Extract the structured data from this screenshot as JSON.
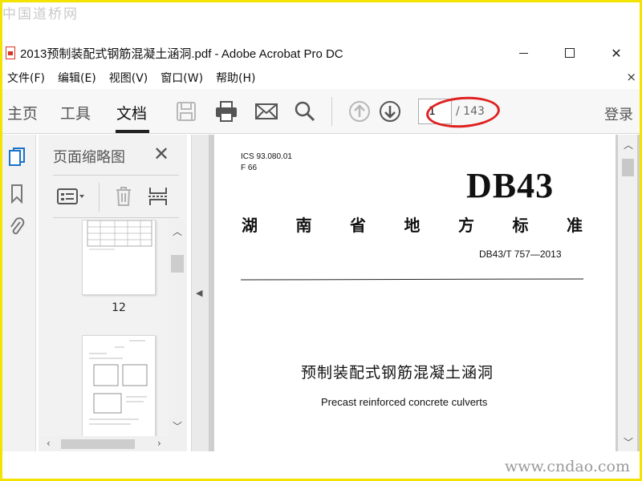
{
  "watermark": {
    "top": "中国道桥网",
    "bottom": "www.cndao.com"
  },
  "window": {
    "title": "2013预制装配式钢筋混凝土涵洞.pdf - Adobe Acrobat Pro DC",
    "close_glyph": "✕"
  },
  "menu": {
    "items": [
      "文件(F)",
      "编辑(E)",
      "视图(V)",
      "窗口(W)",
      "帮助(H)"
    ],
    "close_glyph": "×"
  },
  "toolbar": {
    "tabs": {
      "home": "主页",
      "tools": "工具",
      "document": "文档"
    },
    "page_number": "1",
    "page_total": "/ 143",
    "login": "登录"
  },
  "thumbnails": {
    "title": "页面缩略图",
    "close_glyph": "✕",
    "pages": [
      {
        "label": "12"
      },
      {
        "label": ""
      }
    ]
  },
  "document": {
    "ics": "ICS 93.080.01",
    "f_code": "F 66",
    "db_code": "DB43",
    "std_chars": [
      "湖",
      "南",
      "省",
      "地",
      "方",
      "标",
      "准"
    ],
    "std_number": "DB43/T 757—2013",
    "title_cn": "预制装配式钢筋混凝土涵洞",
    "title_en": "Precast reinforced concrete culverts"
  },
  "colors": {
    "highlight_ellipse": "#e02020",
    "page_border": "#f2e300"
  }
}
